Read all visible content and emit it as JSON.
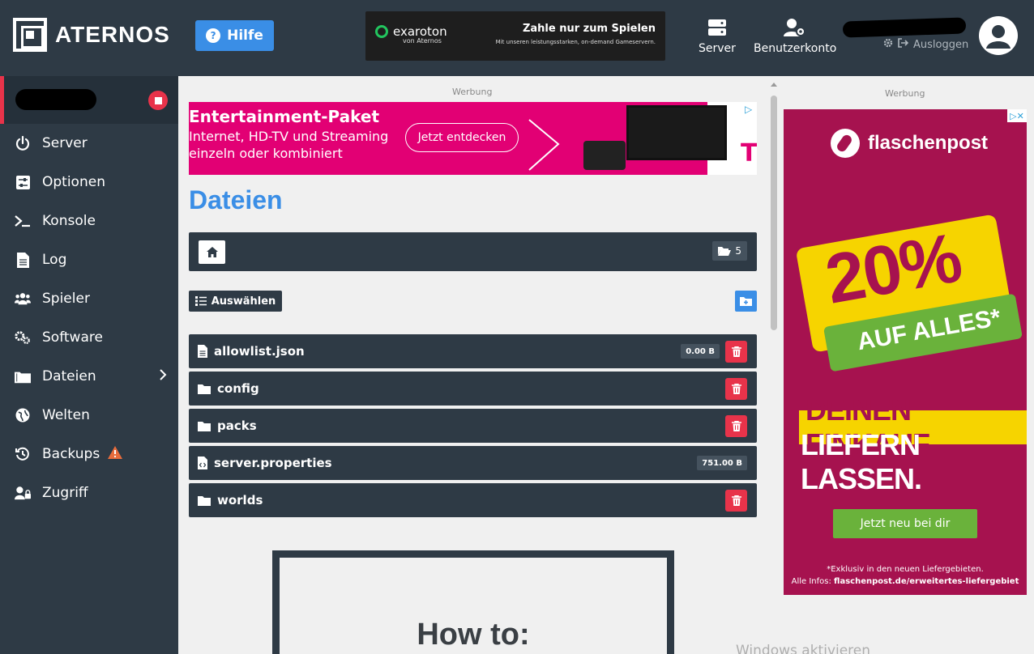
{
  "header": {
    "brand": "ATERNOS",
    "help_label": "Hilfe",
    "top_ad": {
      "brand_name": "exaroton",
      "brand_sub": "von Aternos",
      "slogan": "Zahle nur zum Spielen",
      "slogan_sub": "Mit unseren leistungsstarken, on-demand Gameservern."
    },
    "nav_server": "Server",
    "nav_account": "Benutzerkonto",
    "logout": "Ausloggen"
  },
  "sidebar": {
    "items": [
      {
        "label": "Server",
        "icon": "power-icon"
      },
      {
        "label": "Optionen",
        "icon": "sliders-icon"
      },
      {
        "label": "Konsole",
        "icon": "terminal-icon"
      },
      {
        "label": "Log",
        "icon": "file-icon"
      },
      {
        "label": "Spieler",
        "icon": "users-icon"
      },
      {
        "label": "Software",
        "icon": "gears-icon"
      },
      {
        "label": "Dateien",
        "icon": "folder-icon"
      },
      {
        "label": "Welten",
        "icon": "globe-icon"
      },
      {
        "label": "Backups",
        "icon": "history-icon"
      },
      {
        "label": "Zugriff",
        "icon": "user-lock-icon"
      }
    ]
  },
  "main": {
    "ad_label": "Werbung",
    "banner_ad": {
      "title": "Entertainment-Paket",
      "line1": "Internet, HD-TV und Streaming",
      "line2": "einzeln oder kombiniert",
      "cta": "Jetzt entdecken",
      "brand_mark": "T"
    },
    "page_title": "Dateien",
    "folder_count": "5",
    "select_label": "Auswählen",
    "files": [
      {
        "name": "allowlist.json",
        "type": "file",
        "size": "0.00 B",
        "deletable": true
      },
      {
        "name": "config",
        "type": "folder",
        "size": "",
        "deletable": true
      },
      {
        "name": "packs",
        "type": "folder",
        "size": "",
        "deletable": true
      },
      {
        "name": "server.properties",
        "type": "code-file",
        "size": "751.00 B",
        "deletable": false
      },
      {
        "name": "worlds",
        "type": "folder",
        "size": "",
        "deletable": true
      }
    ],
    "howto_title": "How to:"
  },
  "right_ad": {
    "label": "Werbung",
    "brand": "flaschenpost",
    "percent": "20%",
    "ribbon": "AUF ALLES*",
    "headline1": "DEINEN EINKAUF",
    "headline2": "LIEFERN LASSEN.",
    "cta": "Jetzt neu bei dir",
    "fine1": "*Exklusiv in den neuen Liefergebieten.",
    "fine2_prefix": "Alle Infos: ",
    "fine2_link": "flaschenpost.de/erweitertes-liefergebiet"
  },
  "watermark": "Windows aktivieren",
  "colors": {
    "dark": "#2e3a45",
    "accent": "#3a8ee6",
    "danger": "#e8334a",
    "ad_pink": "#e20074",
    "ad_berry": "#a6124f"
  }
}
